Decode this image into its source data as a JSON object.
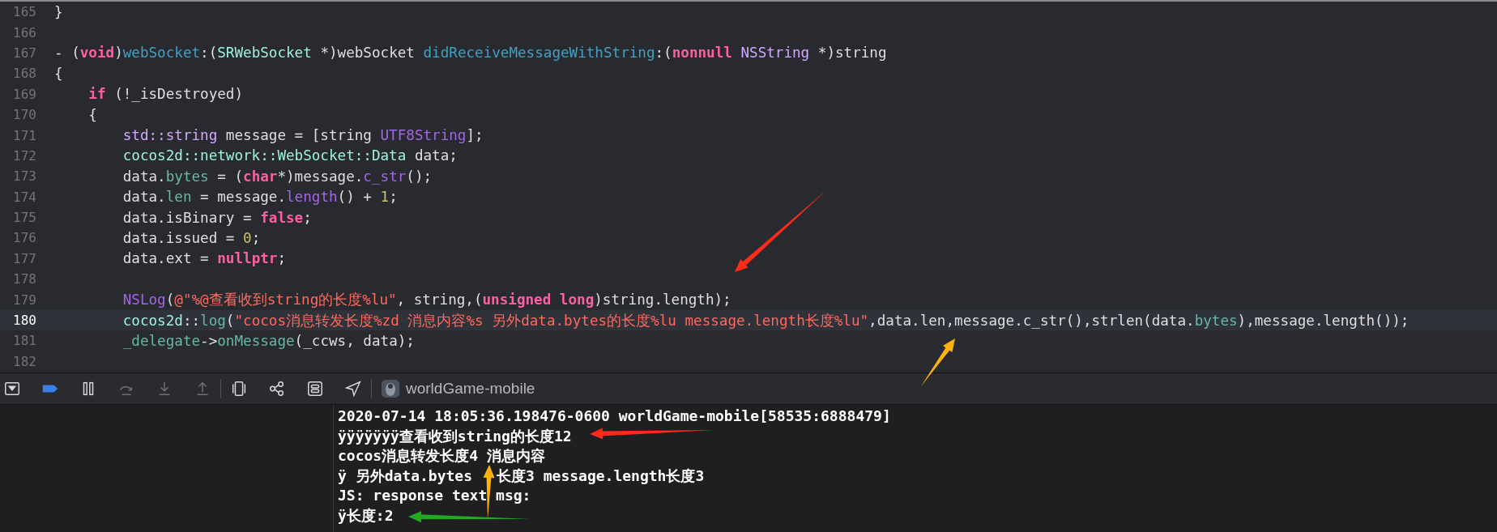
{
  "editor": {
    "lines": [
      {
        "number": "165",
        "current": false,
        "tokens": [
          {
            "kind": "plain",
            "text": "}"
          }
        ]
      },
      {
        "number": "166",
        "current": false
      },
      {
        "number": "167",
        "current": false,
        "tokens": [
          {
            "kind": "plain",
            "text": "- ("
          },
          {
            "kind": "keyword",
            "text": "void"
          },
          {
            "kind": "plain",
            "text": ")"
          },
          {
            "kind": "decl",
            "text": "webSocket"
          },
          {
            "kind": "plain",
            "text": ":("
          },
          {
            "kind": "projtype",
            "text": "SRWebSocket"
          },
          {
            "kind": "plain",
            "text": " *)webSocket "
          },
          {
            "kind": "decl",
            "text": "didReceiveMessageWithString"
          },
          {
            "kind": "plain",
            "text": ":("
          },
          {
            "kind": "keyword",
            "text": "nonnull"
          },
          {
            "kind": "systype",
            "text": " NSString"
          },
          {
            "kind": "plain",
            "text": " *)string"
          }
        ]
      },
      {
        "number": "168",
        "current": false,
        "tokens": [
          {
            "kind": "plain",
            "text": "{"
          }
        ]
      },
      {
        "number": "169",
        "current": false,
        "tokens": [
          {
            "kind": "keyword",
            "text": "    if"
          },
          {
            "kind": "plain",
            "text": " (!_isDestroyed)"
          }
        ]
      },
      {
        "number": "170",
        "current": false,
        "tokens": [
          {
            "kind": "plain",
            "text": "    {"
          }
        ]
      },
      {
        "number": "171",
        "current": false,
        "tokens": [
          {
            "kind": "systype",
            "text": "        std::string"
          },
          {
            "kind": "plain",
            "text": " message = [string "
          },
          {
            "kind": "sysfunc",
            "text": "UTF8String"
          },
          {
            "kind": "plain",
            "text": "];"
          }
        ]
      },
      {
        "number": "172",
        "current": false,
        "tokens": [
          {
            "kind": "projtype",
            "text": "        cocos2d::network::WebSocket::Data"
          },
          {
            "kind": "plain",
            "text": " data;"
          }
        ]
      },
      {
        "number": "173",
        "current": false,
        "tokens": [
          {
            "kind": "plain",
            "text": "        data."
          },
          {
            "kind": "projfunc",
            "text": "bytes"
          },
          {
            "kind": "plain",
            "text": " = ("
          },
          {
            "kind": "keyword",
            "text": "char"
          },
          {
            "kind": "plain",
            "text": "*)message."
          },
          {
            "kind": "sysfunc",
            "text": "c_str"
          },
          {
            "kind": "plain",
            "text": "();"
          }
        ]
      },
      {
        "number": "174",
        "current": false,
        "tokens": [
          {
            "kind": "plain",
            "text": "        data."
          },
          {
            "kind": "projfunc",
            "text": "len"
          },
          {
            "kind": "plain",
            "text": " = message."
          },
          {
            "kind": "sysfunc",
            "text": "length"
          },
          {
            "kind": "plain",
            "text": "() + "
          },
          {
            "kind": "number",
            "text": "1"
          },
          {
            "kind": "plain",
            "text": ";"
          }
        ]
      },
      {
        "number": "175",
        "current": false,
        "tokens": [
          {
            "kind": "plain",
            "text": "        data.isBinary = "
          },
          {
            "kind": "keyword",
            "text": "false"
          },
          {
            "kind": "plain",
            "text": ";"
          }
        ]
      },
      {
        "number": "176",
        "current": false,
        "tokens": [
          {
            "kind": "plain",
            "text": "        data.issued = "
          },
          {
            "kind": "number",
            "text": "0"
          },
          {
            "kind": "plain",
            "text": ";"
          }
        ]
      },
      {
        "number": "177",
        "current": false,
        "tokens": [
          {
            "kind": "plain",
            "text": "        data.ext = "
          },
          {
            "kind": "keyword",
            "text": "nullptr"
          },
          {
            "kind": "plain",
            "text": ";"
          }
        ]
      },
      {
        "number": "178",
        "current": false
      },
      {
        "number": "179",
        "current": false,
        "tokens": [
          {
            "kind": "sysfunc",
            "text": "        NSLog"
          },
          {
            "kind": "plain",
            "text": "("
          },
          {
            "kind": "string",
            "text": "@\"%@查看收到string的长度%lu\""
          },
          {
            "kind": "plain",
            "text": ", string,("
          },
          {
            "kind": "keyword",
            "text": "unsigned long"
          },
          {
            "kind": "plain",
            "text": ")string.length);"
          }
        ]
      },
      {
        "number": "180",
        "current": true,
        "tokens": [
          {
            "kind": "projtype",
            "text": "        cocos2d"
          },
          {
            "kind": "plain",
            "text": "::"
          },
          {
            "kind": "projfunc",
            "text": "log"
          },
          {
            "kind": "plain",
            "text": "("
          },
          {
            "kind": "string",
            "text": "\"cocos消息转发长度%zd 消息内容%s 另外data.bytes的长度%lu message.length长度%lu\""
          },
          {
            "kind": "plain",
            "text": ",data.len,message.c_str(),strlen(data."
          },
          {
            "kind": "projfunc",
            "text": "bytes"
          },
          {
            "kind": "plain",
            "text": "),message.length());"
          }
        ]
      },
      {
        "number": "181",
        "current": false,
        "tokens": [
          {
            "kind": "projfunc",
            "text": "        _delegate"
          },
          {
            "kind": "plain",
            "text": "->"
          },
          {
            "kind": "projfunc",
            "text": "onMessage"
          },
          {
            "kind": "plain",
            "text": "(_ccws, data);"
          }
        ]
      },
      {
        "number": "182",
        "current": false
      }
    ]
  },
  "debug_bar": {
    "buttons": [
      {
        "kind": "hide-console",
        "disabled": false
      },
      {
        "kind": "breakpoints",
        "disabled": false
      },
      {
        "kind": "pause",
        "disabled": false
      },
      {
        "kind": "step-over",
        "disabled": true
      },
      {
        "kind": "step-into",
        "disabled": true
      },
      {
        "kind": "step-out",
        "disabled": true
      },
      {
        "kind": "view-debugger",
        "disabled": false
      },
      {
        "kind": "memory-graph",
        "disabled": false
      },
      {
        "kind": "environment",
        "disabled": false
      },
      {
        "kind": "location",
        "disabled": false
      }
    ],
    "target": "worldGame-mobile"
  },
  "console": {
    "lines": [
      [
        "2020-07-14 18:05:36.198476-0600 worldGame-mobile[58535:6888479]"
      ],
      [
        "ÿÿÿÿÿÿÿ查看收到string的长度12"
      ],
      [
        "cocos消息转发长度4 消息内容"
      ],
      [
        "ÿ 另外data.bytes",
        "长度3 message.length长度3"
      ],
      [
        "JS: response text msg:"
      ],
      [
        "ÿ长度:2"
      ]
    ]
  }
}
